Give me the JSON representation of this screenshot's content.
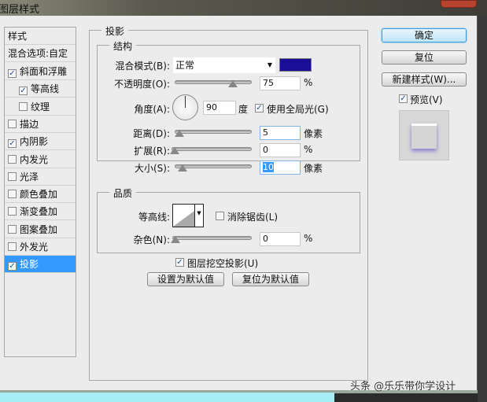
{
  "window": {
    "title": "图层样式"
  },
  "sidebar": {
    "header": "样式",
    "blend_options": "混合选项:自定",
    "items": [
      {
        "label": "斜面和浮雕",
        "checked": true,
        "indent": false
      },
      {
        "label": "等高线",
        "checked": true,
        "indent": true
      },
      {
        "label": "纹理",
        "checked": false,
        "indent": true
      },
      {
        "label": "描边",
        "checked": false,
        "indent": false
      },
      {
        "label": "内阴影",
        "checked": true,
        "indent": false
      },
      {
        "label": "内发光",
        "checked": false,
        "indent": false
      },
      {
        "label": "光泽",
        "checked": false,
        "indent": false
      },
      {
        "label": "颜色叠加",
        "checked": false,
        "indent": false
      },
      {
        "label": "渐变叠加",
        "checked": false,
        "indent": false
      },
      {
        "label": "图案叠加",
        "checked": false,
        "indent": false
      },
      {
        "label": "外发光",
        "checked": false,
        "indent": false
      },
      {
        "label": "投影",
        "checked": true,
        "indent": false,
        "selected": true
      }
    ]
  },
  "main": {
    "title": "投影",
    "structure": {
      "title": "结构",
      "blend_mode_label": "混合模式(B):",
      "blend_mode": "正常",
      "color": "#1a0d96",
      "opacity_label": "不透明度(O):",
      "opacity": "75",
      "opacity_unit": "%",
      "opacity_fraction": 0.75,
      "angle_label": "角度(A):",
      "angle": "90",
      "angle_unit": "度",
      "global_light_label": "使用全局光(G)",
      "global_light": true,
      "distance_label": "距离(D):",
      "distance": "5",
      "distance_unit": "像素",
      "spread_label": "扩展(R):",
      "spread": "0",
      "spread_unit": "%",
      "size_label": "大小(S):",
      "size": "10",
      "size_unit": "像素"
    },
    "quality": {
      "title": "品质",
      "contour_label": "等高线:",
      "antialias_label": "消除锯齿(L)",
      "antialias": false,
      "noise_label": "杂色(N):",
      "noise": "0",
      "noise_unit": "%"
    },
    "knockout_label": "图层挖空投影(U)",
    "knockout": true,
    "set_default": "设置为默认值",
    "reset_default": "复位为默认值"
  },
  "buttons": {
    "ok": "确定",
    "reset": "复位",
    "new_style": "新建样式(W)...",
    "preview_label": "预览(V)",
    "preview": true
  },
  "watermark": "头条 @乐乐带你学设计"
}
